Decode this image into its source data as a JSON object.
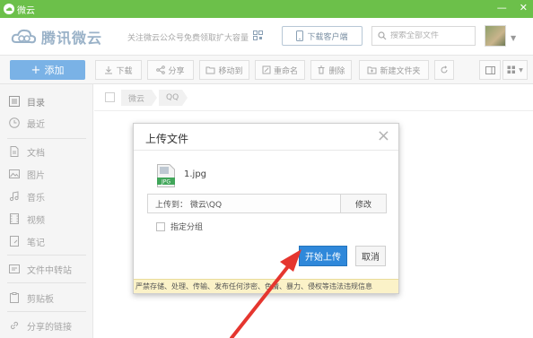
{
  "window": {
    "title": "微云",
    "minimize": "—",
    "close": "✕"
  },
  "header": {
    "logo_text": "腾讯微云",
    "wechat_tip": "关注微云公众号免费领取扩大容量",
    "download_client": "下载客户端",
    "search_placeholder": "搜索全部文件",
    "avatar_caret": "▼"
  },
  "toolbar": {
    "add_label": "添加",
    "buttons": [
      "下载",
      "分享",
      "移动到",
      "重命名",
      "删除",
      "新建文件夹"
    ]
  },
  "sidebar": {
    "items": [
      {
        "label": "目录",
        "icon": "list-icon"
      },
      {
        "label": "最近",
        "icon": "clock-icon"
      },
      {
        "label": "文档",
        "icon": "document-icon"
      },
      {
        "label": "图片",
        "icon": "image-icon"
      },
      {
        "label": "音乐",
        "icon": "music-icon"
      },
      {
        "label": "视频",
        "icon": "video-icon"
      },
      {
        "label": "笔记",
        "icon": "note-icon"
      },
      {
        "label": "文件中转站",
        "icon": "transfer-icon"
      },
      {
        "label": "剪贴板",
        "icon": "clipboard-icon"
      },
      {
        "label": "分享的链接",
        "icon": "link-icon"
      }
    ]
  },
  "breadcrumb": [
    "微云",
    "QQ"
  ],
  "dialog": {
    "title": "上传文件",
    "close": "×",
    "file_name": "1.jpg",
    "file_type": "JPG",
    "destination": "上传到： 微云\\QQ",
    "modify_label": "修改",
    "group_label": "指定分组",
    "start_label": "开始上传",
    "cancel_label": "取消",
    "warning": "严禁存储、处理、传输、发布任何涉密、色情、暴力、侵权等违法违规信息"
  },
  "colors": {
    "titlebar": "#6cc04a",
    "add_button": "#7ab2e6",
    "primary_button": "#2f88da",
    "warning_bg": "#fbf2c8",
    "annotation_arrow": "#e5362f"
  }
}
